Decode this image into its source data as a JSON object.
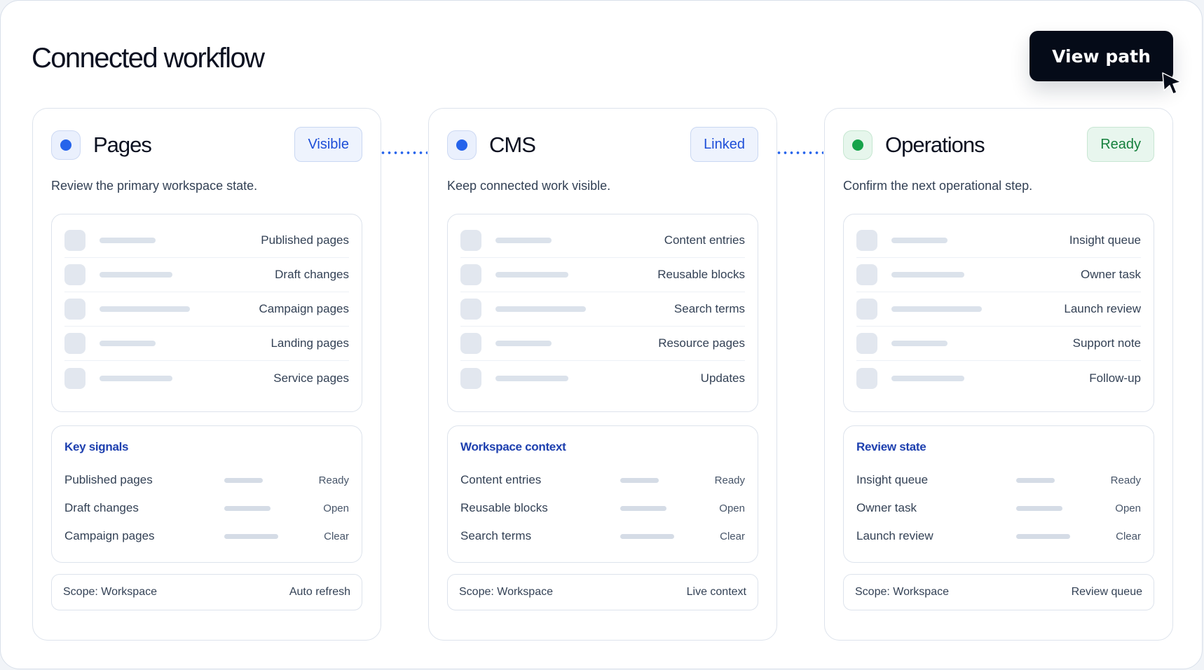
{
  "title": "Connected workflow",
  "view_path_label": "View path",
  "columns": [
    {
      "title": "Pages",
      "badge": "Visible",
      "badge_tone": "blue",
      "description": "Review the primary workspace state.",
      "items": [
        "Published pages",
        "Draft changes",
        "Campaign pages",
        "Landing pages",
        "Service pages"
      ],
      "signals_title": "Key signals",
      "signals": [
        {
          "name": "Published pages",
          "state": "Ready"
        },
        {
          "name": "Draft changes",
          "state": "Open"
        },
        {
          "name": "Campaign pages",
          "state": "Clear"
        }
      ],
      "footer_left": "Scope: Workspace",
      "footer_right": "Auto refresh"
    },
    {
      "title": "CMS",
      "badge": "Linked",
      "badge_tone": "blue",
      "description": "Keep connected work visible.",
      "items": [
        "Content entries",
        "Reusable blocks",
        "Search terms",
        "Resource pages",
        "Updates"
      ],
      "signals_title": "Workspace context",
      "signals": [
        {
          "name": "Content entries",
          "state": "Ready"
        },
        {
          "name": "Reusable blocks",
          "state": "Open"
        },
        {
          "name": "Search terms",
          "state": "Clear"
        }
      ],
      "footer_left": "Scope: Workspace",
      "footer_right": "Live context"
    },
    {
      "title": "Operations",
      "badge": "Ready",
      "badge_tone": "green",
      "description": "Confirm the next operational step.",
      "items": [
        "Insight queue",
        "Owner task",
        "Launch review",
        "Support note",
        "Follow-up"
      ],
      "signals_title": "Review state",
      "signals": [
        {
          "name": "Insight queue",
          "state": "Ready"
        },
        {
          "name": "Owner task",
          "state": "Open"
        },
        {
          "name": "Launch review",
          "state": "Clear"
        }
      ],
      "footer_left": "Scope: Workspace",
      "footer_right": "Review queue"
    }
  ],
  "colors": {
    "accent_blue": "#2563eb",
    "accent_green": "#16a34a",
    "button_dark": "#050b18"
  }
}
